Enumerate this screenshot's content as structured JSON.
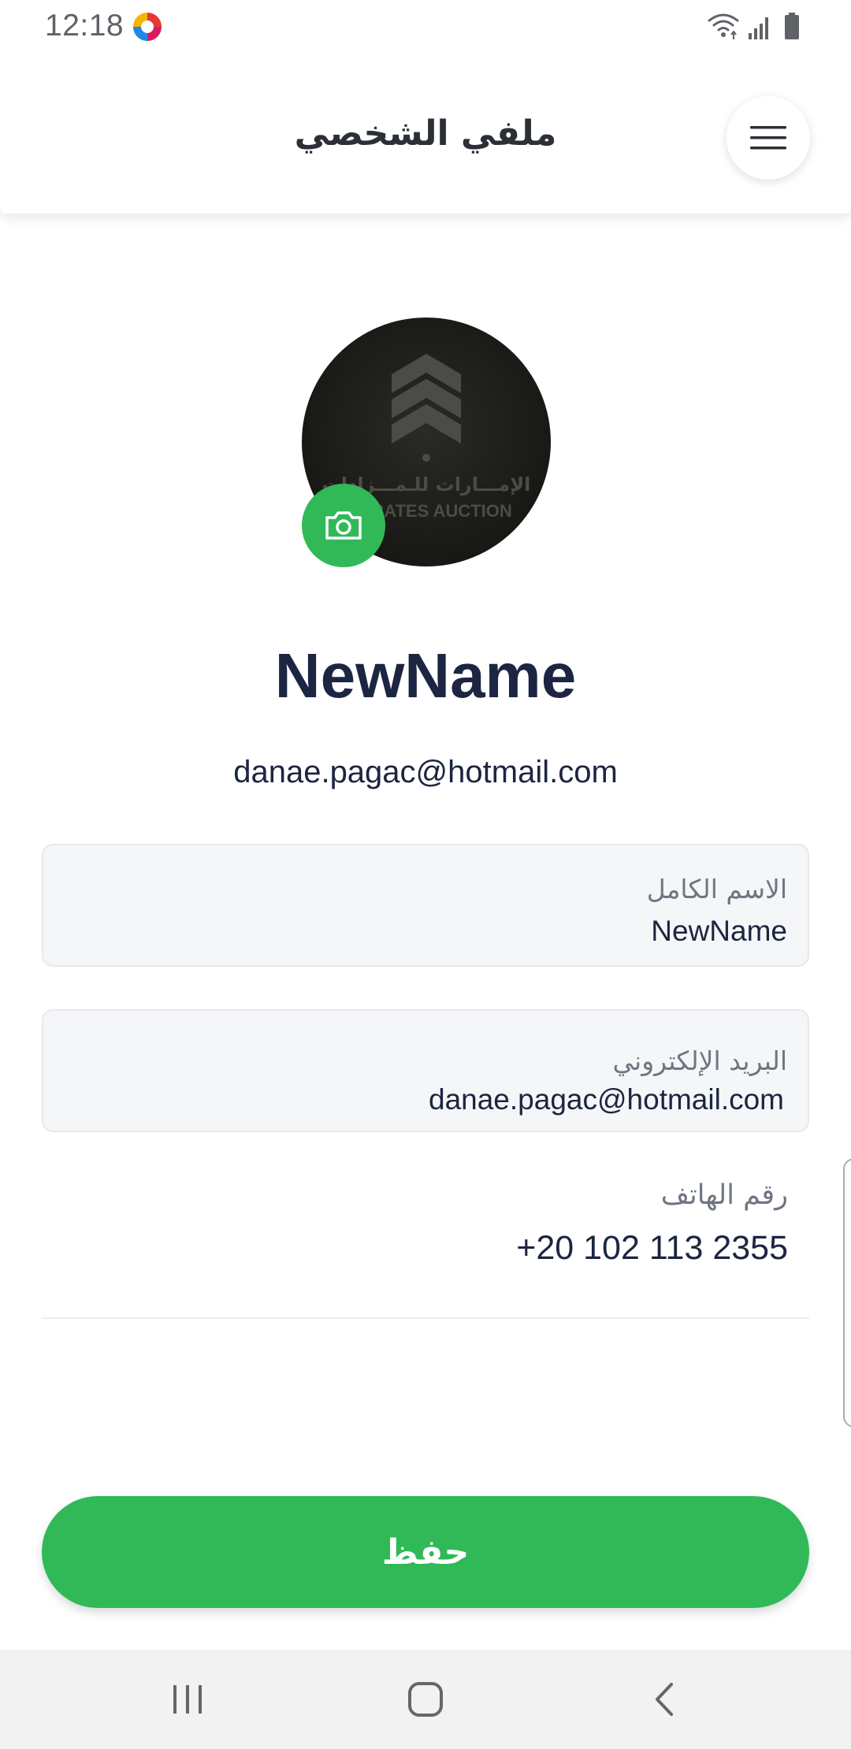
{
  "status_bar": {
    "time": "12:18",
    "app_icon": "colorful-circle-icon",
    "icons": [
      "wifi-icon",
      "signal-icon",
      "battery-icon"
    ]
  },
  "header": {
    "title": "ملفي الشخصي",
    "menu_icon": "hamburger-menu-icon"
  },
  "profile": {
    "avatar_logo_text_ar": "الإمـــارات للـمـــزادات",
    "avatar_logo_text_en": "EMIRATES AUCTION",
    "camera_icon": "camera-icon",
    "name": "NewName",
    "email": "danae.pagac@hotmail.com"
  },
  "form": {
    "full_name": {
      "label": "الاسم الكامل",
      "value": "NewName"
    },
    "email": {
      "label": "البريد الإلكتروني",
      "value": "danae.pagac@hotmail.com"
    },
    "phone": {
      "label": "رقم الهاتف",
      "value": "+20 102 113 2355"
    }
  },
  "save_button": {
    "label": "حفظ"
  },
  "nav_bar": {
    "recents_icon": "recents-icon",
    "home_icon": "home-icon",
    "back_icon": "back-icon"
  },
  "colors": {
    "accent": "#31b957",
    "text_dark": "#1c2541",
    "label_gray": "#6f7682",
    "field_bg": "#f5f6f8"
  }
}
